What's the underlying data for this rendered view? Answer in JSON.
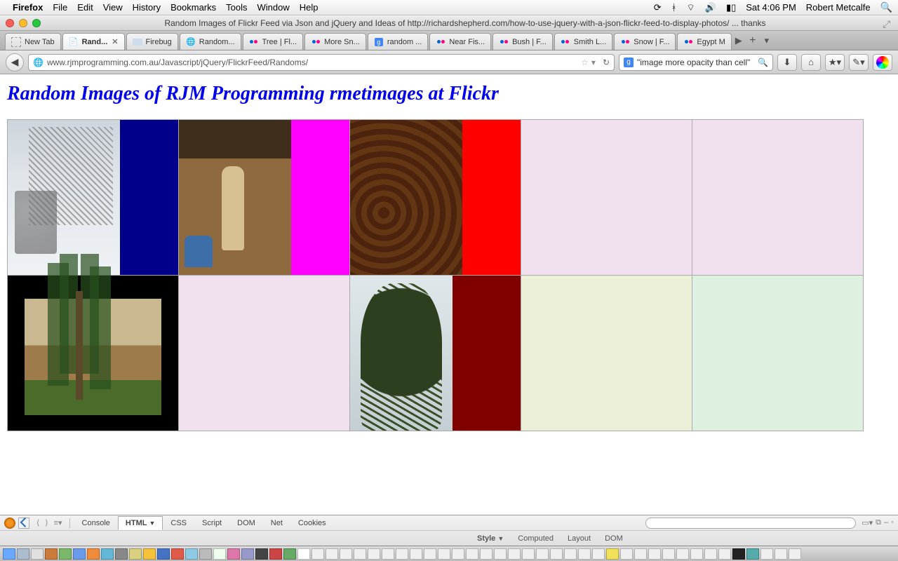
{
  "menubar": {
    "app": "Firefox",
    "items": [
      "File",
      "Edit",
      "View",
      "History",
      "Bookmarks",
      "Tools",
      "Window",
      "Help"
    ],
    "clock": "Sat 4:06 PM",
    "user": "Robert Metcalfe"
  },
  "window": {
    "title": "Random Images of Flickr Feed via Json and jQuery and Ideas of http://richardshepherd.com/how-to-use-jquery-with-a-json-flickr-feed-to-display-photos/ ... thanks"
  },
  "tabs": [
    {
      "label": "New Tab",
      "type": "newtab"
    },
    {
      "label": "Rand...",
      "type": "active"
    },
    {
      "label": "Firebug",
      "type": "firebug"
    },
    {
      "label": "Random...",
      "type": "generic"
    },
    {
      "label": "Tree | Fl...",
      "type": "flickr"
    },
    {
      "label": "More Sn...",
      "type": "flickr"
    },
    {
      "label": "random ...",
      "type": "google"
    },
    {
      "label": "Near Fis...",
      "type": "flickr"
    },
    {
      "label": "Bush | F...",
      "type": "flickr"
    },
    {
      "label": "Smith L...",
      "type": "flickr"
    },
    {
      "label": "Snow | F...",
      "type": "flickr"
    },
    {
      "label": "Egypt M",
      "type": "flickr"
    }
  ],
  "url": "www.rjmprogramming.com.au/Javascript/jQuery/FlickrFeed/Randoms/",
  "search": {
    "value": "\"image more opacity than cell\""
  },
  "page": {
    "heading": "Random Images of RJM Programming rmetimages at Flickr",
    "cells": [
      {
        "img": "img-snow",
        "color": "#00008b"
      },
      {
        "img": "img-statue",
        "color": "#ff00ff"
      },
      {
        "img": "img-tannery",
        "color": "#ff0000"
      },
      {
        "img": "",
        "color": "#f1e1ef"
      },
      {
        "img": "",
        "color": "#f1e1ef"
      },
      {
        "img": "img-palm",
        "color": "#000000"
      },
      {
        "img": "",
        "color": "#f1e1ef"
      },
      {
        "img": "img-tree",
        "color": "#800000"
      },
      {
        "img": "",
        "color": "#edf0d9"
      },
      {
        "img": "",
        "color": "#def1e1"
      }
    ]
  },
  "firebug": {
    "tabs": [
      "Console",
      "HTML",
      "CSS",
      "Script",
      "DOM",
      "Net",
      "Cookies"
    ],
    "active": "HTML",
    "subtabs": [
      "Style",
      "Computed",
      "Layout",
      "DOM"
    ],
    "subactive": "Style"
  }
}
